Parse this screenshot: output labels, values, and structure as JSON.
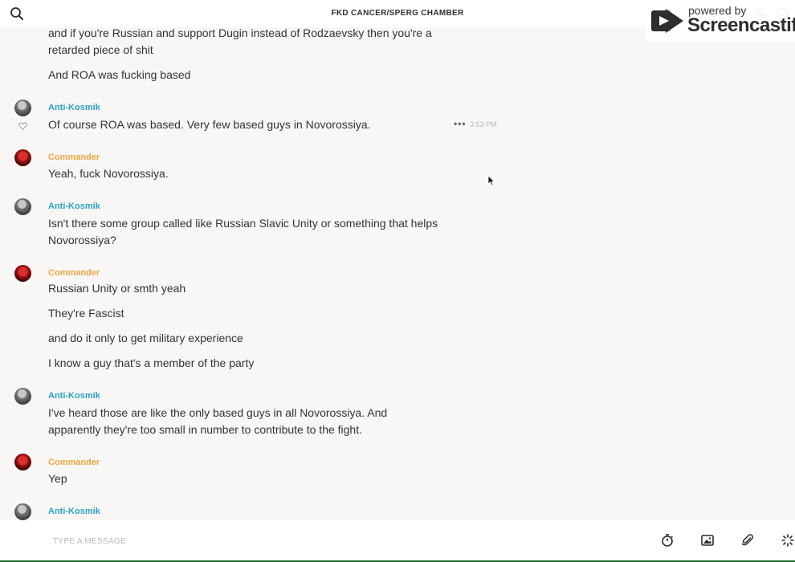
{
  "header": {
    "room_title": "FKD CANCER/SPERG CHAMBER"
  },
  "watermark": {
    "small": "powered by",
    "big": "Screencastify"
  },
  "messages": [
    {
      "author": "",
      "lines": [
        "and if you're Russian and support Dugin instead of Rodzaevsky then you're a retarded piece of shit",
        "And ROA was fucking based"
      ]
    },
    {
      "author": "Anti-Kosmik",
      "lines": [
        "Of course ROA was based. Very few based guys in Novorossiya."
      ],
      "time": "3:53 PM"
    },
    {
      "author": "Commander",
      "lines": [
        "Yeah, fuck Novorossiya."
      ]
    },
    {
      "author": "Anti-Kosmik",
      "lines": [
        "Isn't there some group called like Russian Slavic Unity or something that helps Novorossiya?"
      ]
    },
    {
      "author": "Commander",
      "lines": [
        "Russian Unity or smth yeah",
        "They're Fascist",
        "and do it only to get military experience",
        "I know a guy that's a member of the party"
      ]
    },
    {
      "author": "Anti-Kosmik",
      "lines": [
        "I've heard those are like the only based guys in all Novorossiya. And apparently they're too small in number to contribute to the fight."
      ]
    },
    {
      "author": "Commander",
      "lines": [
        "Yep"
      ]
    },
    {
      "author": "Anti-Kosmik",
      "lines": []
    }
  ],
  "composer": {
    "placeholder": "TYPE A MESSAGE",
    "value": ""
  },
  "icons": {
    "search": "search-icon",
    "phone": "phone-icon",
    "info": "info-icon",
    "heart": "heart-icon",
    "more": "more-icon",
    "timer": "timer-icon",
    "image": "image-icon",
    "attach": "paperclip-icon",
    "sparkle": "sparkle-icon"
  },
  "colors": {
    "author_anti_kosmik": "#2aa3c8",
    "author_commander": "#f0a545",
    "background": "#f8f7f6"
  }
}
